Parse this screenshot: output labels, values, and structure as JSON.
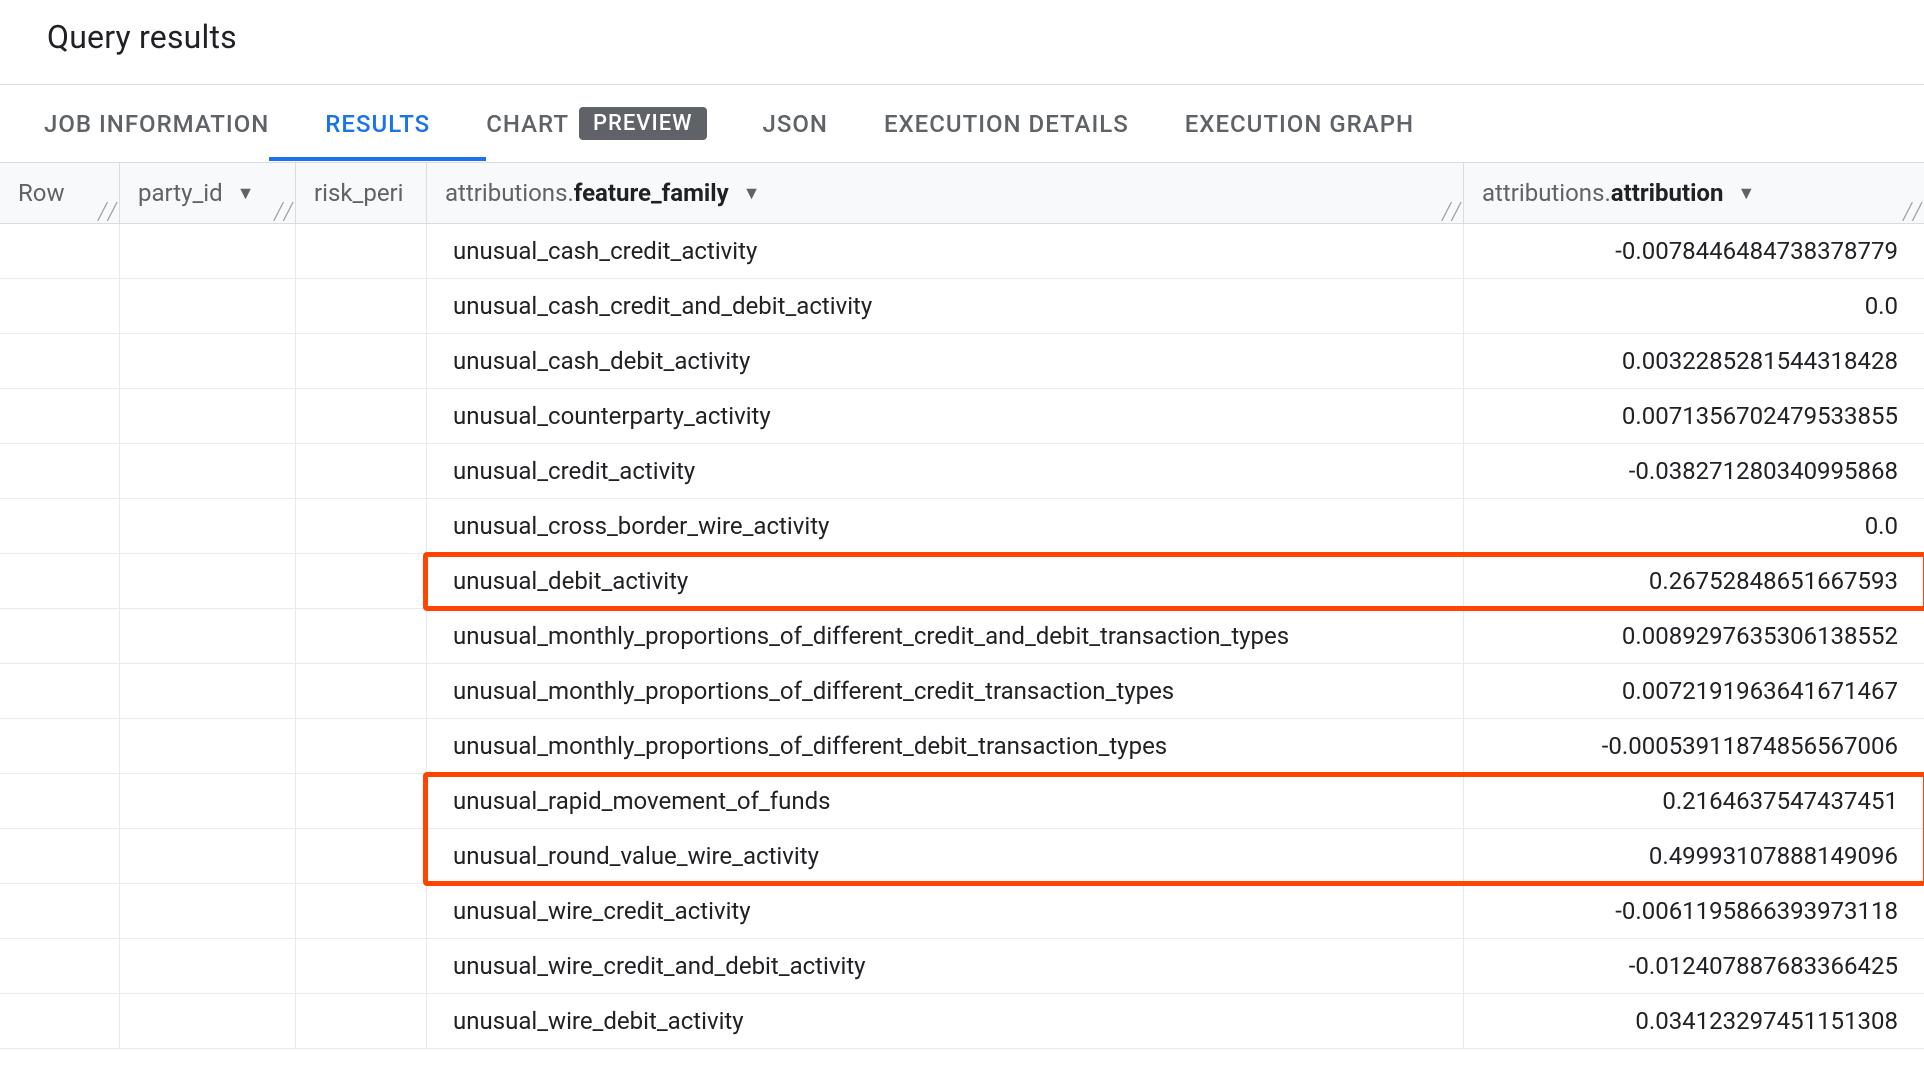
{
  "header": {
    "title": "Query results"
  },
  "tabs": [
    {
      "label": "JOB INFORMATION",
      "active": false
    },
    {
      "label": "RESULTS",
      "active": true
    },
    {
      "label": "CHART",
      "active": false,
      "badge": "PREVIEW"
    },
    {
      "label": "JSON",
      "active": false
    },
    {
      "label": "EXECUTION DETAILS",
      "active": false
    },
    {
      "label": "EXECUTION GRAPH",
      "active": false
    }
  ],
  "columns": {
    "row": "Row",
    "party_id": "party_id",
    "risk_period": "risk_peri",
    "feature_prefix": "attributions.",
    "feature_bold": "feature_family",
    "attr_prefix": "attributions.",
    "attr_bold": "attribution"
  },
  "rows": [
    {
      "feature": "unusual_cash_credit_activity",
      "attribution": "-0.0078446484738378779",
      "highlight": false
    },
    {
      "feature": "unusual_cash_credit_and_debit_activity",
      "attribution": "0.0",
      "highlight": false
    },
    {
      "feature": "unusual_cash_debit_activity",
      "attribution": "0.0032285281544318428",
      "highlight": false
    },
    {
      "feature": "unusual_counterparty_activity",
      "attribution": "0.0071356702479533855",
      "highlight": false
    },
    {
      "feature": "unusual_credit_activity",
      "attribution": "-0.038271280340995868",
      "highlight": false
    },
    {
      "feature": "unusual_cross_border_wire_activity",
      "attribution": "0.0",
      "highlight": false
    },
    {
      "feature": "unusual_debit_activity",
      "attribution": "0.26752848651667593",
      "highlight": true
    },
    {
      "feature": "unusual_monthly_proportions_of_different_credit_and_debit_transaction_types",
      "attribution": "0.0089297635306138552",
      "highlight": false
    },
    {
      "feature": "unusual_monthly_proportions_of_different_credit_transaction_types",
      "attribution": "0.0072191963641671467",
      "highlight": false
    },
    {
      "feature": "unusual_monthly_proportions_of_different_debit_transaction_types",
      "attribution": "-0.00053911874856567006",
      "highlight": false
    },
    {
      "feature": "unusual_rapid_movement_of_funds",
      "attribution": "0.2164637547437451",
      "highlight": true
    },
    {
      "feature": "unusual_round_value_wire_activity",
      "attribution": "0.49993107888149096",
      "highlight": true
    },
    {
      "feature": "unusual_wire_credit_activity",
      "attribution": "-0.0061195866393973118",
      "highlight": false
    },
    {
      "feature": "unusual_wire_credit_and_debit_activity",
      "attribution": "-0.012407887683366425",
      "highlight": false
    },
    {
      "feature": "unusual_wire_debit_activity",
      "attribution": "0.034123297451151308",
      "highlight": false
    }
  ]
}
